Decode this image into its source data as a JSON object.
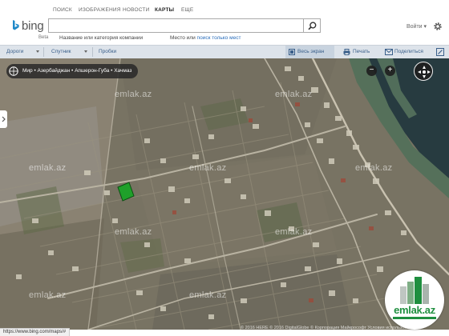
{
  "topnav": {
    "items": [
      {
        "label": "ПОИСК",
        "active": false
      },
      {
        "label": "ИЗОБРАЖЕНИЯ",
        "active": false
      },
      {
        "label": "НОВОСТИ",
        "active": false
      },
      {
        "label": "КАРТЫ",
        "active": true
      },
      {
        "label": "ЕЩЕ",
        "active": false
      }
    ]
  },
  "header": {
    "logo": "bing",
    "logo_sub": "Beta",
    "what_placeholder": "",
    "where_placeholder": "",
    "what_label": "Название или категория компании",
    "where_label_prefix": "Место или ",
    "where_label_link": "поиск только мест",
    "signin": "Войти ▾",
    "search_icon": "search-icon",
    "settings_icon": "gear-icon"
  },
  "toolbar": {
    "roads": "Дороги",
    "satellite": "Спутник",
    "traffic": "Пробки",
    "fullscreen": "Весь экран",
    "print": "Печать",
    "share": "Поделиться",
    "accent": "#3a5f8a"
  },
  "map": {
    "breadcrumb": "Мир • Азербайджан • Апшерон-Губа • Хачмаз",
    "zoom_out": "−",
    "zoom_in": "+",
    "watermark": "emlak.az",
    "marker_color": "#1fa02a",
    "copyright": "© 2016 HERE   © 2016 DigitalGlobe   © Корпорация Майкрософт   Условия использования"
  },
  "status": {
    "url": "https://www.bing.com/maps/#"
  },
  "badge": {
    "name": "emlak.az"
  }
}
